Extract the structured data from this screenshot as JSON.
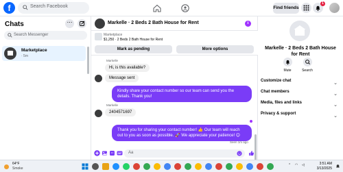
{
  "topbar": {
    "search_placeholder": "Search Facebook",
    "find_friends": "Find friends",
    "notification_count": "1"
  },
  "left": {
    "title": "Chats",
    "search_placeholder": "Search Messenger",
    "chat": {
      "name": "Marketplace",
      "meta": "· 5m"
    }
  },
  "conversation": {
    "title": "Markelle · 2 Beds 2 Bath House for Rent",
    "marketplace_label": "Marketplace",
    "listing": "$1,250 · 2 Beds 2 Bath House for Rent",
    "mark_pending": "Mark as pending",
    "more_options": "More options",
    "messages": [
      {
        "sender": "Markelle",
        "text": "Hi, is this available?"
      },
      {
        "text": "Message sent"
      },
      {
        "text": "Kindly share your contact number so our team can send you the details. Thank you!"
      },
      {
        "sender": "Markelle",
        "text": "2404571697"
      },
      {
        "text": "Thank you for sharing your contact number! 👍 Our team will reach out to you as soon as possible. 🚀 We appreciate your patience! 😊"
      }
    ],
    "seen_text": "Seen 1m ago",
    "composer_placeholder": "Aa"
  },
  "right": {
    "name": "Markelle · 2 Beds 2 Bath House for Rent",
    "mute": "Mute",
    "search": "Search",
    "sections": [
      "Customize chat",
      "Chat members",
      "Media, files and links",
      "Privacy & support"
    ]
  },
  "taskbar": {
    "temp": "64°F",
    "condition": "Smoke",
    "time": "3:51 AM",
    "date": "3/13/2025"
  },
  "colors": {
    "accent": "#7a3cf7",
    "facebook_blue": "#0866ff",
    "badge_red": "#e41e3f"
  }
}
